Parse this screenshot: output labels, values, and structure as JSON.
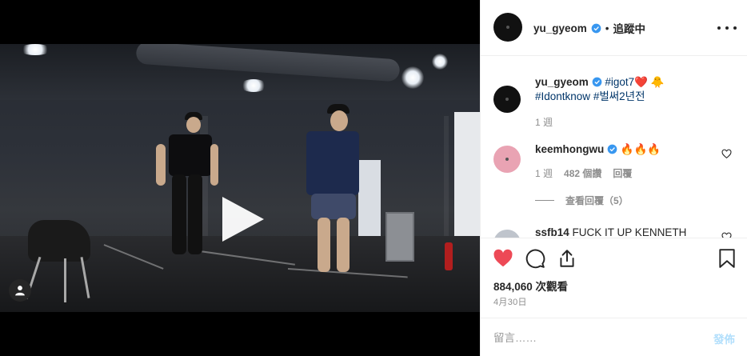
{
  "header": {
    "username": "yu_gyeom",
    "separator": "•",
    "follow_status": "追蹤中"
  },
  "caption": {
    "username": "yu_gyeom",
    "hashtag1": "#igot7",
    "emoji1": "❤️",
    "emoji2": "🐥",
    "hashtag2": "#Idontknow",
    "hashtag3": "#벌써2년전",
    "time": "1 週"
  },
  "comments": [
    {
      "username": "keemhongwu",
      "text": "🔥🔥🔥",
      "time": "1 週",
      "likes": "482 個讚",
      "reply": "回覆",
      "view_replies": "查看回覆（5）"
    },
    {
      "username": "ssfb14",
      "text": "FUCK IT UP KENNETH"
    }
  ],
  "stats": {
    "views": "884,060 次觀看",
    "date": "4月30日"
  },
  "comment_box": {
    "placeholder": "留言……",
    "post_label": "發佈"
  },
  "colors": {
    "like_red": "#ed4956",
    "verified_blue": "#3897f0",
    "hashtag_blue": "#003569",
    "muted": "#8e8e8e",
    "post_disabled": "#b2dffc"
  },
  "icons": {
    "play": "play-icon",
    "user_tag": "user-tag-icon",
    "more": "more-options-icon",
    "like": "heart-filled-icon",
    "comment": "comment-icon",
    "share": "share-icon",
    "save": "bookmark-icon"
  }
}
